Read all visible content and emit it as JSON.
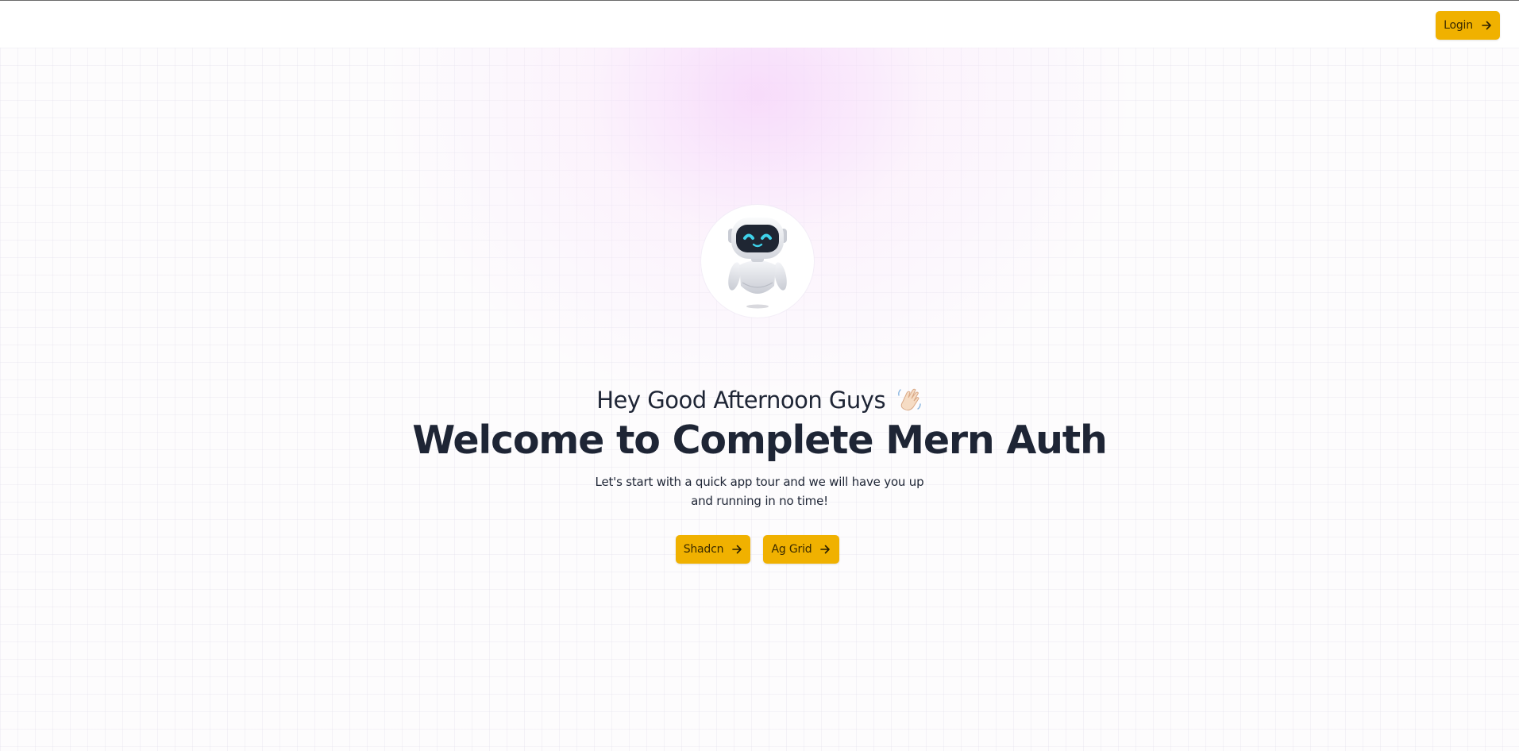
{
  "header": {
    "login_label": "Login",
    "login_icon": "arrow-right-icon"
  },
  "hero": {
    "avatar_icon": "robot-icon",
    "greeting": "Hey Good Afternoon Guys",
    "greeting_icon": "waving-hand-icon",
    "title": "Welcome to Complete Mern Auth",
    "subtitle": "Let's start with a quick app tour and we will have you up and running in no time!",
    "buttons": [
      {
        "label": "Shadcn",
        "icon": "arrow-right-icon"
      },
      {
        "label": "Ag Grid",
        "icon": "arrow-right-icon"
      }
    ]
  },
  "colors": {
    "accent": "#f0b100",
    "text": "#1e2535",
    "background": "#ffffff",
    "glow": "#f6d6fa"
  }
}
